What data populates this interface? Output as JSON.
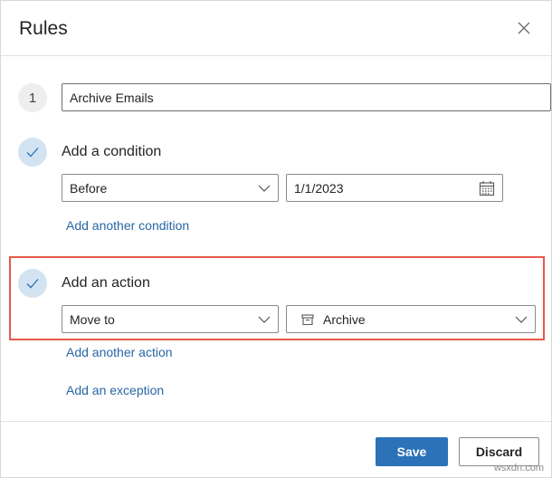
{
  "dialog": {
    "title": "Rules",
    "close_icon": "close-icon"
  },
  "rule_name": {
    "step_number": "1",
    "value": "Archive Emails"
  },
  "condition": {
    "label": "Add a condition",
    "icon": "check-icon",
    "type_value": "Before",
    "date_value": "1/1/2023",
    "date_icon": "calendar-icon",
    "add_another": "Add another condition"
  },
  "action": {
    "label": "Add an action",
    "icon": "check-icon",
    "type_value": "Move to",
    "folder_value": "Archive",
    "folder_icon": "archive-icon",
    "add_another": "Add another action"
  },
  "exception": {
    "add_label": "Add an exception"
  },
  "footer": {
    "save_label": "Save",
    "discard_label": "Discard"
  },
  "watermark": "wsxdn.com",
  "colors": {
    "primary": "#2b72b8",
    "link": "#2766a7",
    "highlight": "#e8584a",
    "check_bg": "#d3e3f1"
  }
}
